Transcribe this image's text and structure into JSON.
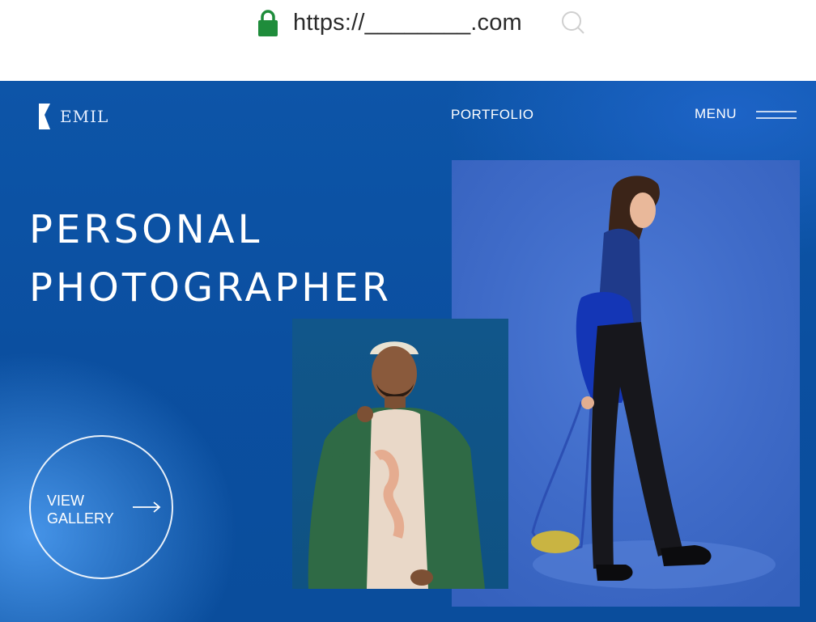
{
  "browser": {
    "url": "https://________.com",
    "lock_icon": "lock-icon",
    "search_icon": "search-icon",
    "lock_color": "#1f8c3b"
  },
  "site": {
    "logo_text": "EMIL",
    "nav": {
      "portfolio": "PORTFOLIO",
      "menu": "MENU",
      "menu_icon": "hamburger-icon"
    },
    "headline": {
      "line1": "PERSONAL",
      "line2": "PHOTOGRAPHER"
    },
    "cta": {
      "label": "VIEW\nGALLERY",
      "icon": "arrow-right-icon"
    },
    "colors": {
      "hero_blue": "#0b4fa0",
      "text": "#ffffff"
    },
    "images": {
      "woman": "photo-woman-walking",
      "man": "photo-man-green-jacket"
    }
  }
}
